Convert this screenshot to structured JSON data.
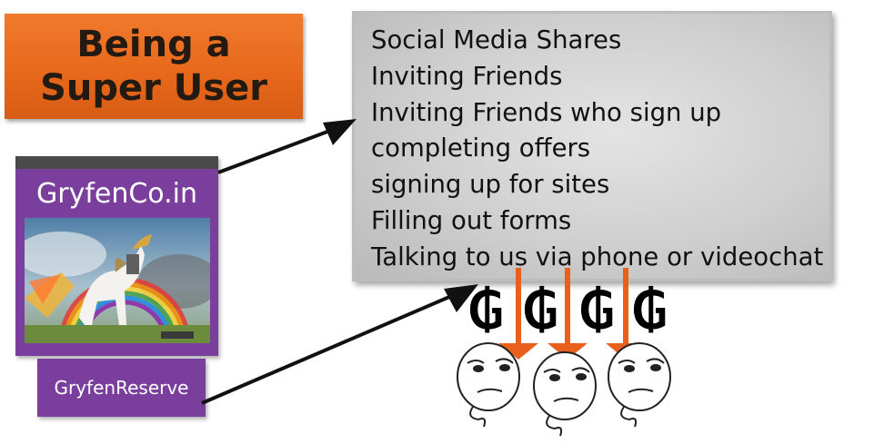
{
  "title": "Being a Super User",
  "info_panel": {
    "items": [
      "Social Media Shares",
      "Inviting Friends",
      "Inviting Friends who sign up",
      "completing offers",
      "signing up for sites",
      "Filling out forms",
      "Talking to us via phone or videochat"
    ]
  },
  "site_card": {
    "name": "GryfenCo.in"
  },
  "reserve": {
    "label": "GryfenReserve"
  },
  "colors": {
    "title_bg": "#e8691c",
    "card_bg": "#7a3f9c",
    "panel_bg": "#cfcfcf",
    "arrow_orange": "#e8601c"
  },
  "icons": [
    "currency-symbol-icon",
    "thinking-face-icon"
  ]
}
